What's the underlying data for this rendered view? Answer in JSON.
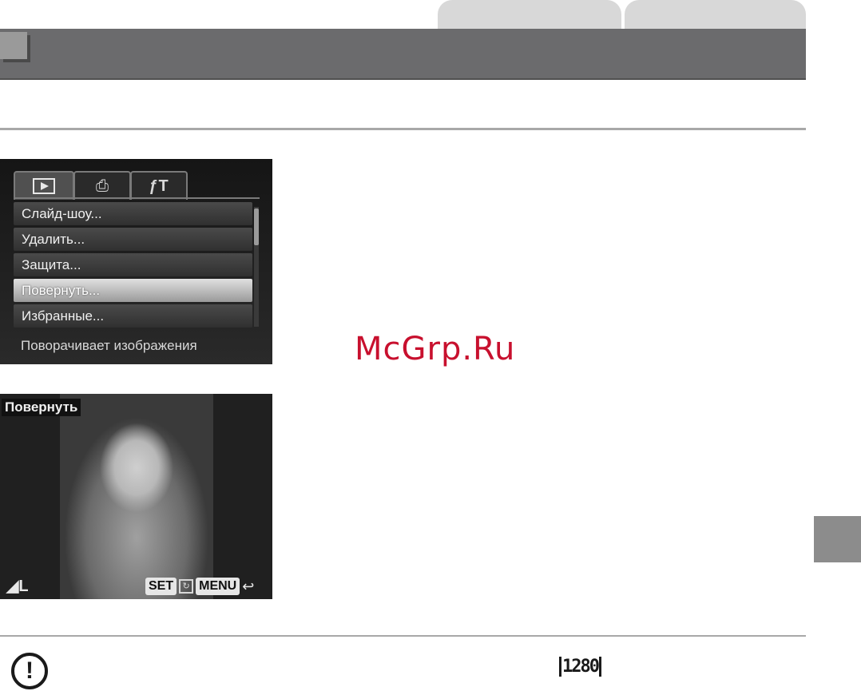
{
  "camera_menu": {
    "tabs": [
      "play-icon",
      "print-icon",
      "tools-icon"
    ],
    "items": [
      {
        "label": "Слайд-шоу..."
      },
      {
        "label": "Удалить..."
      },
      {
        "label": "Защита..."
      },
      {
        "label": "Повернуть..."
      },
      {
        "label": "Избранные..."
      }
    ],
    "selected_index": 3,
    "description": "Поворачивает изображения"
  },
  "watermark": "McGrp.Ru",
  "rotate_screen": {
    "title": "Повернуть",
    "size_label": "L",
    "set_label": "SET",
    "menu_label": "MENU"
  },
  "note": {
    "icon": "caution-icon",
    "resolution_label": "1280"
  }
}
